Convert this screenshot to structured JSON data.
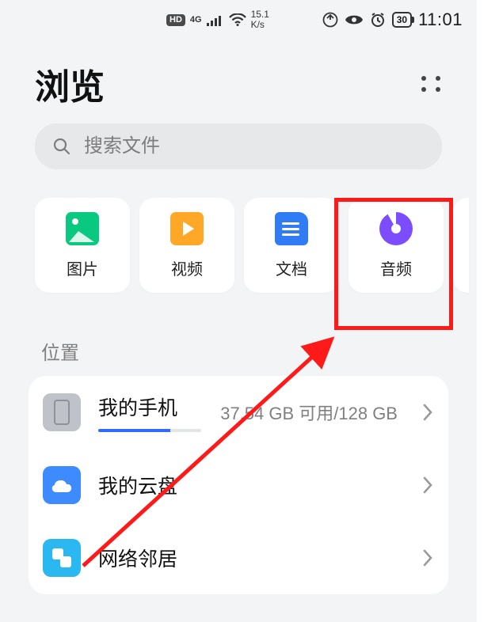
{
  "status_bar": {
    "hd": "HD",
    "net_4g": "4G",
    "net_speed_top": "15.1",
    "net_speed_bottom": "K/s",
    "battery": "30",
    "time": "11:01"
  },
  "header": {
    "title": "浏览"
  },
  "search": {
    "placeholder": "搜索文件"
  },
  "categories": [
    {
      "key": "images",
      "label": "图片",
      "icon": "image-icon"
    },
    {
      "key": "video",
      "label": "视频",
      "icon": "video-icon"
    },
    {
      "key": "docs",
      "label": "文档",
      "icon": "document-icon"
    },
    {
      "key": "audio",
      "label": "音频",
      "icon": "audio-icon"
    }
  ],
  "section": {
    "locations_label": "位置"
  },
  "locations": {
    "phone": {
      "title": "我的手机",
      "storage_text": "37.54 GB 可用/128 GB",
      "used_pct": 70
    },
    "cloud": {
      "title": "我的云盘"
    },
    "network": {
      "title": "网络邻居"
    }
  },
  "annotation": {
    "highlighted_category_index": 3,
    "highlight_color": "#ff1a1a"
  }
}
